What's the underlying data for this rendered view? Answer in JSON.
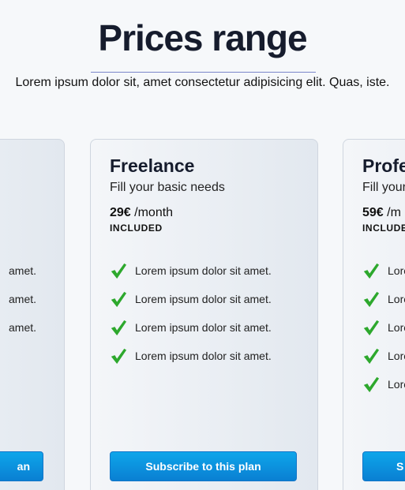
{
  "header": {
    "title": "Prices range",
    "subtitle": "Lorem ipsum dolor sit, amet consectetur adipisicing elit. Quas, iste."
  },
  "plans": [
    {
      "visible_name": "",
      "features": [
        "amet.",
        "amet.",
        "amet."
      ],
      "button_label": "an"
    },
    {
      "name": "Freelance",
      "description": "Fill your basic needs",
      "price": "29€",
      "period": "/month",
      "included_label": "INCLUDED",
      "features": [
        "Lorem ipsum dolor sit amet.",
        "Lorem ipsum dolor sit amet.",
        "Lorem ipsum dolor sit amet.",
        "Lorem ipsum dolor sit amet."
      ],
      "button_label": "Subscribe to this plan"
    },
    {
      "name": "Profe",
      "description": "Fill your",
      "price": "59€",
      "period": "/m",
      "included_label": "INCLUDE",
      "features": [
        "Lore",
        "Lore",
        "Lore",
        "Lore",
        "Lore"
      ],
      "button_label": "S"
    }
  ],
  "colors": {
    "accent": "#0a8fdc",
    "check": "#2da82d",
    "title": "#161c2d"
  },
  "icons": {
    "feature_icon": "checkmark-icon"
  }
}
